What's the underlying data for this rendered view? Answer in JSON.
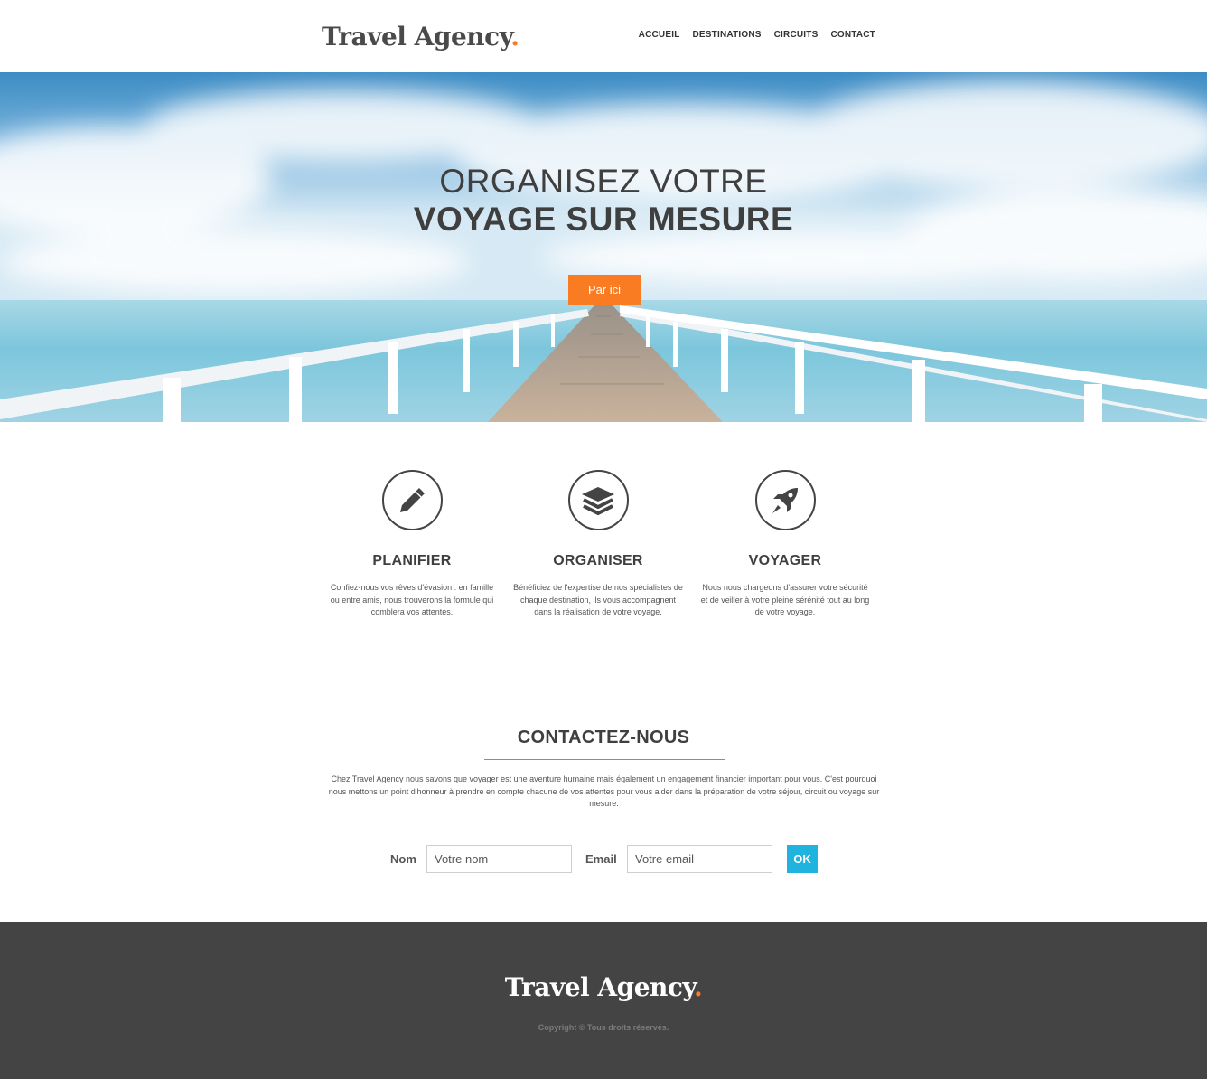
{
  "header": {
    "logo_text": "Travel Agency",
    "logo_dot": ".",
    "nav": [
      {
        "label": "ACCUEIL"
      },
      {
        "label": "DESTINATIONS"
      },
      {
        "label": "CIRCUITS"
      },
      {
        "label": "CONTACT"
      }
    ]
  },
  "hero": {
    "line1": "ORGANISEZ VOTRE",
    "line2": "VOYAGE SUR MESURE",
    "button_label": "Par ici"
  },
  "features": [
    {
      "icon": "pen-icon",
      "title": "PLANIFIER",
      "text": "Confiez-nous vos rêves d'évasion : en famille ou entre amis, nous trouverons la formule qui comblera vos attentes."
    },
    {
      "icon": "layers-icon",
      "title": "ORGANISER",
      "text": "Bénéficiez de l'expertise de nos spécialistes de chaque destination, ils vous accompagnent dans la réalisation de votre voyage."
    },
    {
      "icon": "rocket-icon",
      "title": "VOYAGER",
      "text": "Nous nous chargeons d'assurer votre sécurité et de veiller à votre pleine sérénité tout au long de votre voyage."
    }
  ],
  "contact": {
    "title": "CONTACTEZ-NOUS",
    "text": "Chez Travel Agency nous savons que voyager est une aventure humaine mais également un engagement financier important pour vous. C'est pourquoi nous mettons un point d'honneur à prendre en compte chacune de vos attentes pour vous aider dans la préparation de votre séjour, circuit ou voyage sur mesure.",
    "name_label": "Nom",
    "name_placeholder": "Votre nom",
    "email_label": "Email",
    "email_placeholder": "Votre email",
    "submit_label": "OK"
  },
  "footer": {
    "logo_text": "Travel Agency",
    "logo_dot": ".",
    "copyright": "Copyright © Tous droits réservés."
  },
  "colors": {
    "accent": "#f97b22",
    "secondary": "#1fb3dd",
    "text": "#444444",
    "footer_bg": "#444444"
  }
}
